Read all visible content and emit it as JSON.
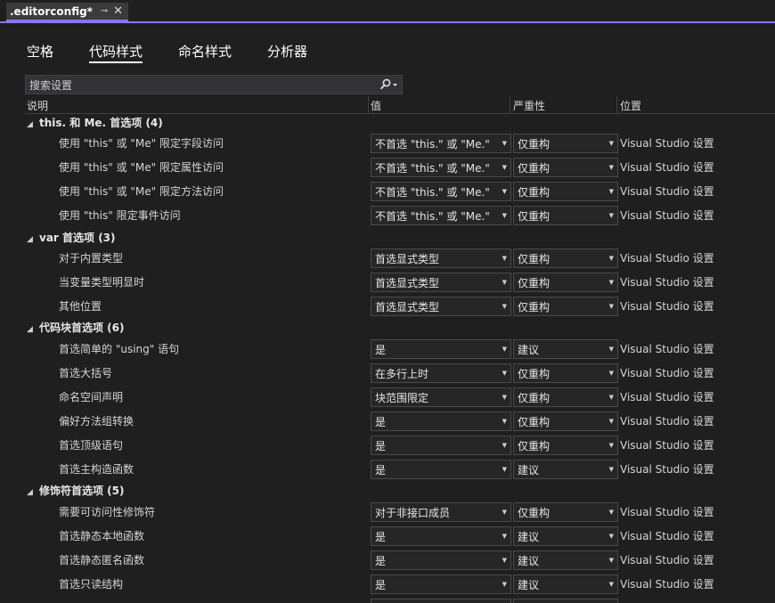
{
  "tab": {
    "title": ".editorconfig*",
    "pin_glyph": "⊸",
    "close_glyph": "✕"
  },
  "categories": [
    {
      "label": "空格",
      "active": false
    },
    {
      "label": "代码样式",
      "active": true
    },
    {
      "label": "命名样式",
      "active": false
    },
    {
      "label": "分析器",
      "active": false
    }
  ],
  "search": {
    "placeholder": "搜索设置"
  },
  "columns": {
    "description": "说明",
    "value": "值",
    "severity": "严重性",
    "location": "位置"
  },
  "groups": [
    {
      "title": "this. 和 Me. 首选项 (4)",
      "rows": [
        {
          "desc": "使用 \"this\" 或 \"Me\" 限定字段访问",
          "value": "不首选 \"this.\" 或 \"Me.\"",
          "severity": "仅重构",
          "location": "Visual Studio 设置"
        },
        {
          "desc": "使用 \"this\" 或 \"Me\" 限定属性访问",
          "value": "不首选 \"this.\" 或 \"Me.\"",
          "severity": "仅重构",
          "location": "Visual Studio 设置"
        },
        {
          "desc": "使用 \"this\" 或 \"Me\" 限定方法访问",
          "value": "不首选 \"this.\" 或 \"Me.\"",
          "severity": "仅重构",
          "location": "Visual Studio 设置"
        },
        {
          "desc": "使用 \"this\" 限定事件访问",
          "value": "不首选 \"this.\" 或 \"Me.\"",
          "severity": "仅重构",
          "location": "Visual Studio 设置"
        }
      ]
    },
    {
      "title": "var 首选项 (3)",
      "rows": [
        {
          "desc": "对于内置类型",
          "value": "首选显式类型",
          "severity": "仅重构",
          "location": "Visual Studio 设置"
        },
        {
          "desc": "当变量类型明显时",
          "value": "首选显式类型",
          "severity": "仅重构",
          "location": "Visual Studio 设置"
        },
        {
          "desc": "其他位置",
          "value": "首选显式类型",
          "severity": "仅重构",
          "location": "Visual Studio 设置"
        }
      ]
    },
    {
      "title": "代码块首选项 (6)",
      "rows": [
        {
          "desc": "首选简单的 \"using\" 语句",
          "value": "是",
          "severity": "建议",
          "location": "Visual Studio 设置"
        },
        {
          "desc": "首选大括号",
          "value": "在多行上时",
          "severity": "仅重构",
          "location": "Visual Studio 设置"
        },
        {
          "desc": "命名空间声明",
          "value": "块范围限定",
          "severity": "仅重构",
          "location": "Visual Studio 设置"
        },
        {
          "desc": "偏好方法组转换",
          "value": "是",
          "severity": "仅重构",
          "location": "Visual Studio 设置"
        },
        {
          "desc": "首选顶级语句",
          "value": "是",
          "severity": "仅重构",
          "location": "Visual Studio 设置"
        },
        {
          "desc": "首选主构造函数",
          "value": "是",
          "severity": "建议",
          "location": "Visual Studio 设置"
        }
      ]
    },
    {
      "title": "修饰符首选项 (5)",
      "rows": [
        {
          "desc": "需要可访问性修饰符",
          "value": "对于非接口成员",
          "severity": "仅重构",
          "location": "Visual Studio 设置"
        },
        {
          "desc": "首选静态本地函数",
          "value": "是",
          "severity": "建议",
          "location": "Visual Studio 设置"
        },
        {
          "desc": "首选静态匿名函数",
          "value": "是",
          "severity": "建议",
          "location": "Visual Studio 设置"
        },
        {
          "desc": "首选只读结构",
          "value": "是",
          "severity": "建议",
          "location": "Visual Studio 设置"
        }
      ]
    }
  ],
  "colors": {
    "accent": "#8b77e8",
    "background": "#1f1f1f"
  }
}
